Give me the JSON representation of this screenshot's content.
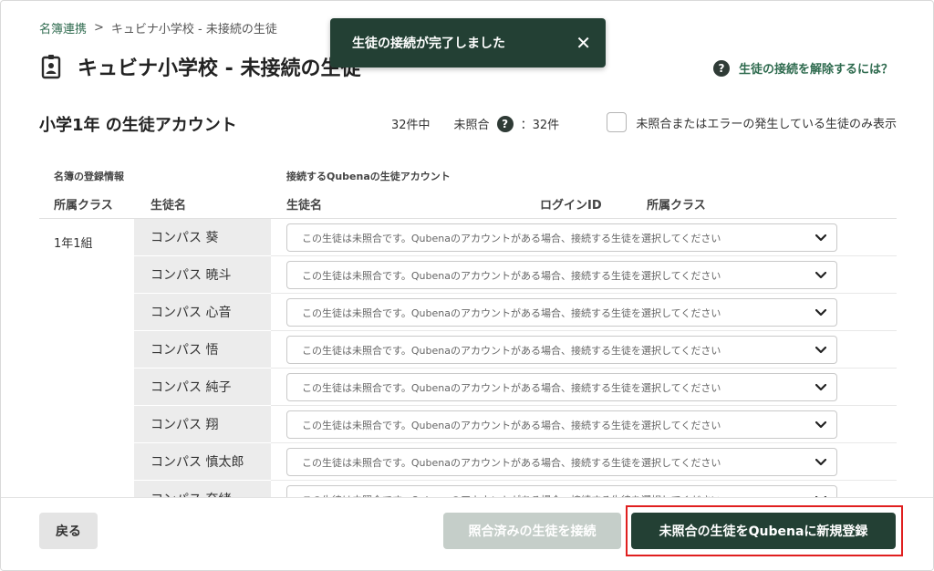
{
  "breadcrumb": {
    "parent": "名簿連携",
    "separator": ">",
    "current": "キュビナ小学校 - 未接続の生徒"
  },
  "page": {
    "title": "キュビナ小学校 - 未接続の生徒"
  },
  "toast": {
    "message": "生徒の接続が完了しました",
    "close_icon": "✕"
  },
  "help": {
    "icon": "?",
    "label": "生徒の接続を解除するには？"
  },
  "section": {
    "title": "小学1年 の生徒アカウント",
    "total": "32件中",
    "unmatched_label": "未照合",
    "unmatched_count": "：32件",
    "filter_label": "未照合またはエラーの発生している生徒のみ表示"
  },
  "columns": {
    "roster_group": "名簿の登録情報",
    "qubena_group": "接続するQubenaの生徒アカウント",
    "class": "所属クラス",
    "name": "生徒名",
    "q_name": "生徒名",
    "login_id": "ログインID",
    "q_class": "所属クラス"
  },
  "table": {
    "class_name": "1年1組",
    "placeholder": "この生徒は未照合です。Qubenaのアカウントがある場合、接続する生徒を選択してください",
    "students": [
      "コンパス 葵",
      "コンパス 暁斗",
      "コンパス 心音",
      "コンパス 悟",
      "コンパス 純子",
      "コンパス 翔",
      "コンパス 慎太郎",
      "コンパス 奈緒"
    ]
  },
  "footer": {
    "back": "戻る",
    "connect_matched": "照合済みの生徒を接続",
    "register_unmatched": "未照合の生徒をQubenaに新規登録"
  },
  "colors": {
    "primary": "#234034",
    "accent_text": "#2f6b4f",
    "highlight": "#e01f1f",
    "disabled": "#c5cec9"
  }
}
